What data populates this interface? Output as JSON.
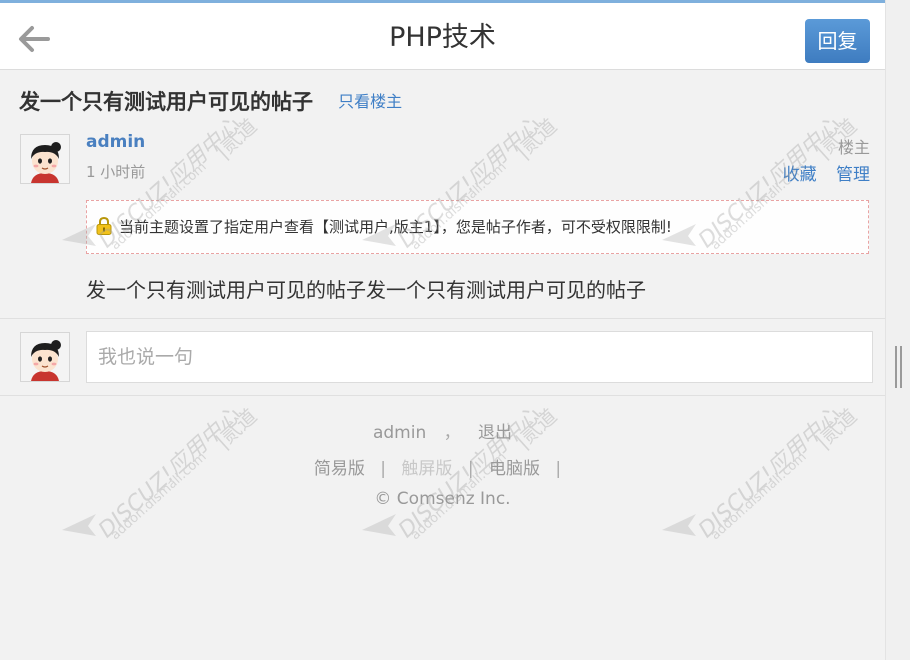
{
  "header": {
    "title": "PHP技术",
    "reply_label": "回复"
  },
  "thread": {
    "title": "发一个只有测试用户可见的帖子",
    "only_author_label": "只看楼主"
  },
  "post": {
    "author": "admin",
    "time": "1 小时前",
    "floor": "楼主",
    "actions": {
      "favorite": "收藏",
      "manage": "管理"
    },
    "notice": "当前主题设置了指定用户查看【测试用户,版主1】，您是帖子作者，可不受权限限制!",
    "content": "发一个只有测试用户可见的帖子发一个只有测试用户可见的帖子"
  },
  "reply_box": {
    "placeholder": "我也说一句"
  },
  "footer": {
    "user": "admin",
    "comma": "，",
    "logout": "退出",
    "links": [
      "简易版",
      "触屏版",
      "电脑版"
    ],
    "separator": "|",
    "copyright": "© Comsenz Inc."
  },
  "watermark": {
    "brand": "DISCUZ!应用中心",
    "url": "addon.dismall.com",
    "cn": "|贰道"
  },
  "colors": {
    "accent": "#3f7fc6",
    "reply_button": "#4a87c9",
    "notice_border": "#e9a3a3",
    "header_top": "#7fb0dd"
  },
  "icons": {
    "back": "arrow-left-icon",
    "lock": "lock-icon",
    "avatar": "avatar-cartoon"
  }
}
